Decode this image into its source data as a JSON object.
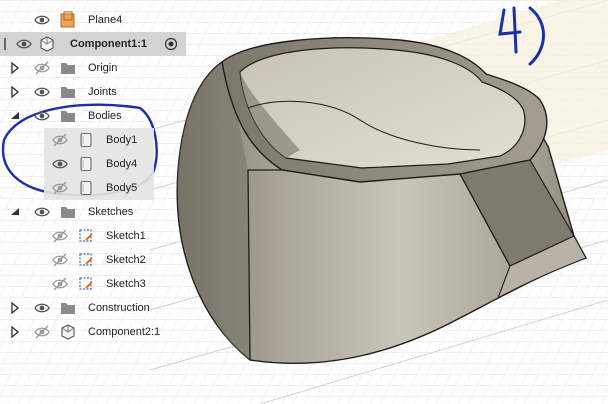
{
  "browser": {
    "rows": [
      {
        "id": "plane4",
        "label": "Plane4",
        "icon": "plane-icon",
        "visibility": "visible"
      },
      {
        "id": "component1",
        "label": "Component1:1",
        "icon": "component-icon",
        "visibility": "visible",
        "active": true
      },
      {
        "id": "origin",
        "label": "Origin",
        "icon": "folder-icon",
        "visibility": "hidden"
      },
      {
        "id": "joints",
        "label": "Joints",
        "icon": "folder-icon",
        "visibility": "visible"
      },
      {
        "id": "bodies",
        "label": "Bodies",
        "icon": "folder-icon",
        "visibility": "visible",
        "expanded": true
      },
      {
        "id": "body1",
        "label": "Body1",
        "icon": "body-icon",
        "visibility": "hidden"
      },
      {
        "id": "body4",
        "label": "Body4",
        "icon": "body-icon",
        "visibility": "visible"
      },
      {
        "id": "body5",
        "label": "Body5",
        "icon": "body-icon",
        "visibility": "hidden"
      },
      {
        "id": "sketches",
        "label": "Sketches",
        "icon": "folder-icon",
        "visibility": "visible",
        "expanded": true
      },
      {
        "id": "sketch1",
        "label": "Sketch1",
        "icon": "sketch-icon",
        "visibility": "hidden"
      },
      {
        "id": "sketch2",
        "label": "Sketch2",
        "icon": "sketch-icon",
        "visibility": "hidden"
      },
      {
        "id": "sketch3",
        "label": "Sketch3",
        "icon": "sketch-icon",
        "visibility": "hidden"
      },
      {
        "id": "construction",
        "label": "Construction",
        "icon": "folder-icon",
        "visibility": "visible"
      },
      {
        "id": "component2",
        "label": "Component2:1",
        "icon": "component-icon",
        "visibility": "hidden"
      }
    ]
  },
  "annotation": {
    "text": "4)",
    "color": "#1a2fa8"
  },
  "colors": {
    "model_face": "#9d9788",
    "model_edge": "#1f1d1a",
    "grid": "#dcdcdc",
    "annotation": "#1a2fa8"
  }
}
